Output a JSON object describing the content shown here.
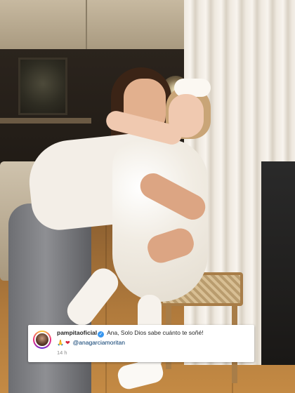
{
  "photo": {
    "description_icon": "photo-scene"
  },
  "comment": {
    "avatar_icon": "profile-avatar-icon",
    "username": "pampitaoficial",
    "verified_icon": "verified-badge-icon",
    "verified_glyph": "✓",
    "text": "Ana, Solo Dios sabe cuánto te soñé!",
    "emoji_hands": "🙏",
    "emoji_heart": "❤",
    "mention": "@anagarciamoritan",
    "timestamp": "14 h",
    "colors": {
      "verified": "#3897f0",
      "mention": "#00376b",
      "timestamp": "#8e8e8e"
    }
  }
}
